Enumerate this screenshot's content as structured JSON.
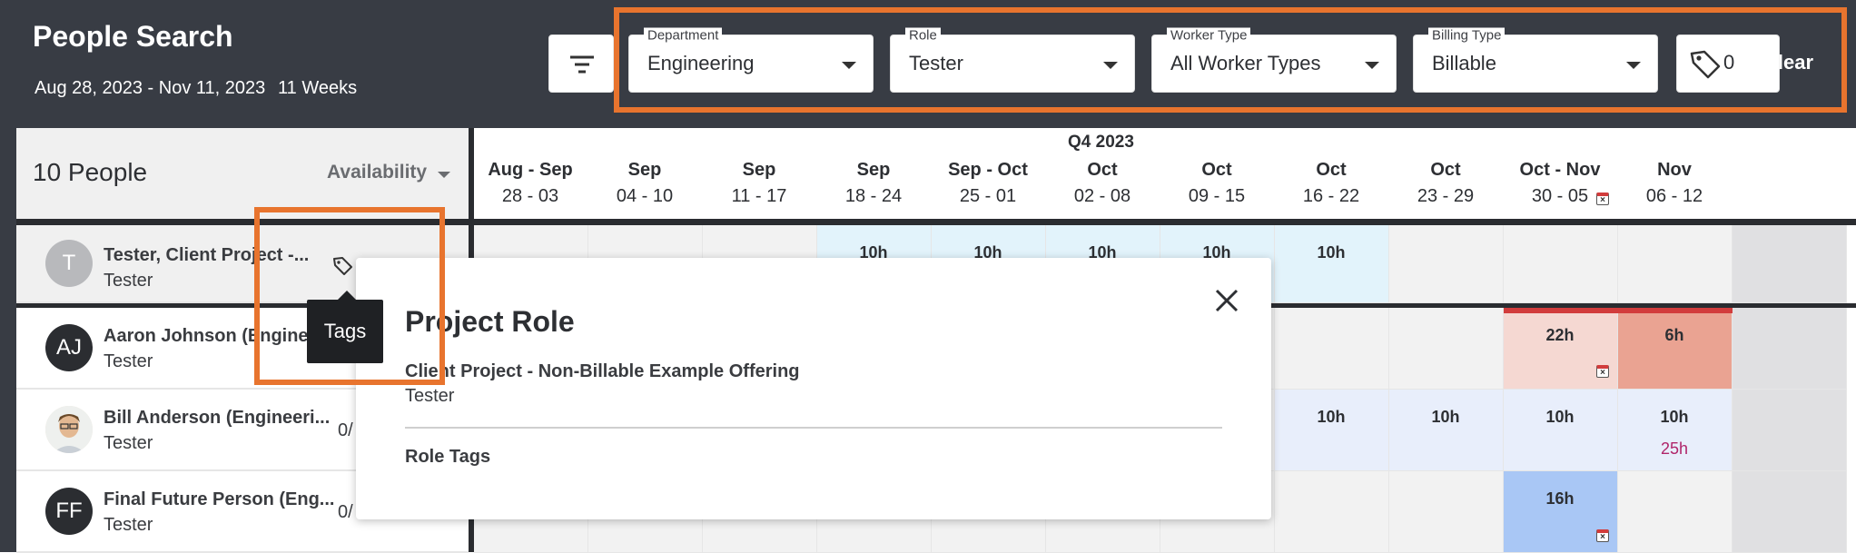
{
  "header": {
    "title": "People Search",
    "date_range": "Aug 28, 2023 - Nov 11, 2023",
    "weeks": "11 Weeks",
    "filters": [
      {
        "label": "Department",
        "value": "Engineering"
      },
      {
        "label": "Role",
        "value": "Tester"
      },
      {
        "label": "Worker Type",
        "value": "All Worker Types"
      },
      {
        "label": "Billing Type",
        "value": "Billable"
      }
    ],
    "tag_count": "0",
    "clear_label": "Clear"
  },
  "left": {
    "people_count": "10 People",
    "sort_label": "Availability"
  },
  "rows": [
    {
      "avatar": "T",
      "avatar_color": "#b8b9bc",
      "name": "Tester, Client Project -...",
      "role": "Tester",
      "frac": ""
    },
    {
      "avatar": "AJ",
      "avatar_color": "#2b2d31",
      "name": "Aaron Johnson (Enginee",
      "role": "Tester",
      "frac": ""
    },
    {
      "avatar": "",
      "avatar_color": "#e8d9c4",
      "name": "Bill Anderson (Engineeri...",
      "role": "Tester",
      "frac": "0/"
    },
    {
      "avatar": "FF",
      "avatar_color": "#2b2d31",
      "name": "Final Future Person (Eng...",
      "role": "Tester",
      "frac": "0/"
    }
  ],
  "timeline": {
    "quarter": "Q4 2023",
    "weeks": [
      {
        "top": "Aug - Sep",
        "bottom": "28 - 03"
      },
      {
        "top": "Sep",
        "bottom": "04 - 10"
      },
      {
        "top": "Sep",
        "bottom": "11 - 17"
      },
      {
        "top": "Sep",
        "bottom": "18 - 24"
      },
      {
        "top": "Sep - Oct",
        "bottom": "25 - 01"
      },
      {
        "top": "Oct",
        "bottom": "02 - 08"
      },
      {
        "top": "Oct",
        "bottom": "09 - 15"
      },
      {
        "top": "Oct",
        "bottom": "16 - 22"
      },
      {
        "top": "Oct",
        "bottom": "23 - 29"
      },
      {
        "top": "Oct - Nov",
        "bottom": "30 - 05"
      },
      {
        "top": "Nov",
        "bottom": "06 - 12"
      }
    ],
    "row_hours": [
      [
        "",
        "",
        "",
        "10h",
        "10h",
        "10h",
        "10h",
        "10h",
        "",
        "",
        ""
      ],
      [
        "",
        "",
        "",
        "",
        "",
        "",
        "",
        "",
        "",
        "22h",
        "6h"
      ],
      [
        "",
        "",
        "",
        "",
        "",
        "",
        "",
        "10h",
        "10h",
        "10h",
        "10h"
      ],
      [
        "",
        "",
        "",
        "",
        "",
        "",
        "",
        "",
        "",
        "16h",
        ""
      ]
    ],
    "overbooked_label": "25h"
  },
  "tooltip": "Tags",
  "popup": {
    "title": "Project Role",
    "project": "Client Project - Non-Billable Example Offering",
    "role": "Tester",
    "tags_heading": "Role Tags"
  },
  "colors": {
    "header_bg": "#383c44",
    "highlight": "#e8742e",
    "assigned_blue": "#e2f3fb",
    "light_blue": "#e8eefb",
    "over_light": "#f5d8d2",
    "over_dark": "#eaa392",
    "strong_blue": "#a9c7f5",
    "red_bar": "#d23c3c"
  }
}
